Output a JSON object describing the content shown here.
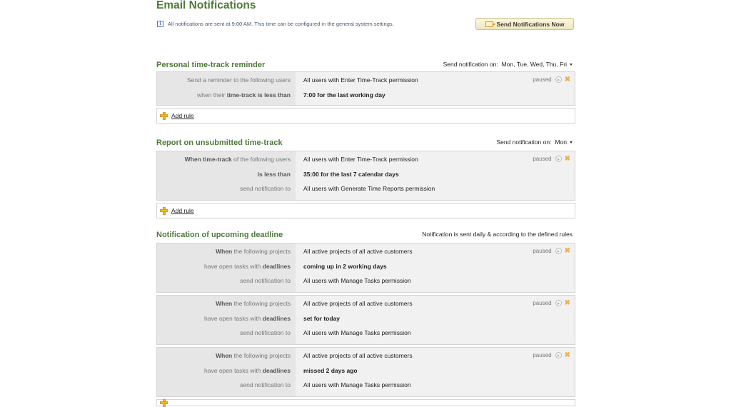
{
  "page": {
    "title": "Email Notifications",
    "info_text": "All notifications are sent at 9:00 AM. This time can be configured in the general system settings.",
    "send_button": "Send Notifications Now",
    "add_rule": "Add rule",
    "paused": "paused"
  },
  "sections": [
    {
      "title": "Personal time-track reminder",
      "schedule_label": "Send notification on:",
      "schedule_value": "Mon, Tue, Wed, Thu, Fri",
      "rules": [
        {
          "rows": [
            {
              "label_pre": "Send a reminder to the following users",
              "label_bold": "",
              "label_post": "",
              "value": "All users with Enter Time-Track permission"
            },
            {
              "label_pre": "when their ",
              "label_bold": "time-track is less than",
              "label_post": "",
              "value": "7:00 for the last  working day"
            }
          ]
        }
      ]
    },
    {
      "title": "Report on unsubmitted time-track",
      "schedule_label": "Send notification on:",
      "schedule_value": "Mon",
      "rules": [
        {
          "rows": [
            {
              "label_pre": "",
              "label_bold": "When time-track",
              "label_post": " of the following users",
              "value": "All users with Enter Time-Track permission"
            },
            {
              "label_pre": "",
              "label_bold": "is less than",
              "label_post": "",
              "value": "35:00 for the last 7  calendar days"
            },
            {
              "label_pre": "send notification to",
              "label_bold": "",
              "label_post": "",
              "value": "All users with Generate Time Reports permission"
            }
          ]
        }
      ]
    },
    {
      "title": "Notification of upcoming deadline",
      "schedule_text": "Notification is sent daily & according to the defined rules",
      "rules": [
        {
          "rows": [
            {
              "label_pre": "",
              "label_bold": "When",
              "label_post": " the following projects",
              "value": "All active projects of all active customers"
            },
            {
              "label_pre": "have open tasks with ",
              "label_bold": "deadlines",
              "label_post": "",
              "value": "coming up in 2 working days"
            },
            {
              "label_pre": "send notification to",
              "label_bold": "",
              "label_post": "",
              "value": "All users with Manage Tasks permission"
            }
          ]
        },
        {
          "rows": [
            {
              "label_pre": "",
              "label_bold": "When",
              "label_post": " the following projects",
              "value": "All active projects of all active customers"
            },
            {
              "label_pre": "have open tasks with ",
              "label_bold": "deadlines",
              "label_post": "",
              "value": "set for today"
            },
            {
              "label_pre": "send notification to",
              "label_bold": "",
              "label_post": "",
              "value": "All users with Manage Tasks permission"
            }
          ]
        },
        {
          "rows": [
            {
              "label_pre": "",
              "label_bold": "When",
              "label_post": " the following projects",
              "value": "All active projects of all active customers"
            },
            {
              "label_pre": "have open tasks with ",
              "label_bold": "deadlines",
              "label_post": "",
              "value": "missed 2 days ago"
            },
            {
              "label_pre": "send notification to",
              "label_bold": "",
              "label_post": "",
              "value": "All users with Manage Tasks permission"
            }
          ]
        }
      ]
    }
  ]
}
